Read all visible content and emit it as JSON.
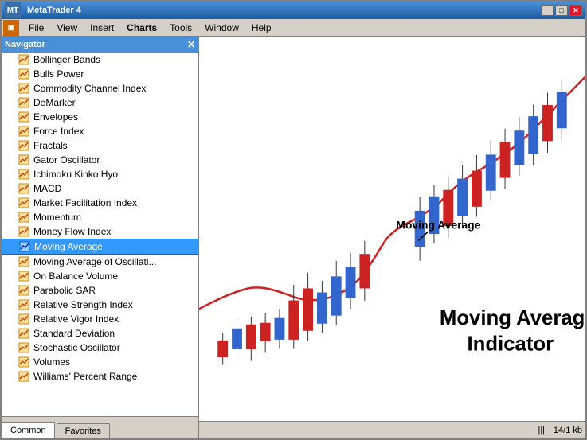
{
  "window": {
    "title": "MetaTrader 4",
    "title_icon": "MT"
  },
  "menu": {
    "app_icon": "F",
    "items": [
      "File",
      "View",
      "Insert",
      "Charts",
      "Tools",
      "Window",
      "Help"
    ]
  },
  "navigator": {
    "title": "Navigator",
    "indicators": [
      "Bollinger Bands",
      "Bulls Power",
      "Commodity Channel Index",
      "DeMarker",
      "Envelopes",
      "Force Index",
      "Fractals",
      "Gator Oscillator",
      "Ichimoku Kinko Hyo",
      "MACD",
      "Market Facilitation Index",
      "Momentum",
      "Money Flow Index",
      "Moving Average",
      "Moving Average of Oscillati...",
      "On Balance Volume",
      "Parabolic SAR",
      "Relative Strength Index",
      "Relative Vigor Index",
      "Standard Deviation",
      "Stochastic Oscillator",
      "Volumes",
      "Williams' Percent Range"
    ],
    "selected_index": 13,
    "tabs": [
      "Common",
      "Favorites"
    ]
  },
  "chart": {
    "label_small": "Moving Average",
    "label_large_line1": "Moving Average",
    "label_large_line2": "Indicator"
  },
  "status_bar": {
    "bars_icon": "||||",
    "size_info": "14/1 kb"
  }
}
